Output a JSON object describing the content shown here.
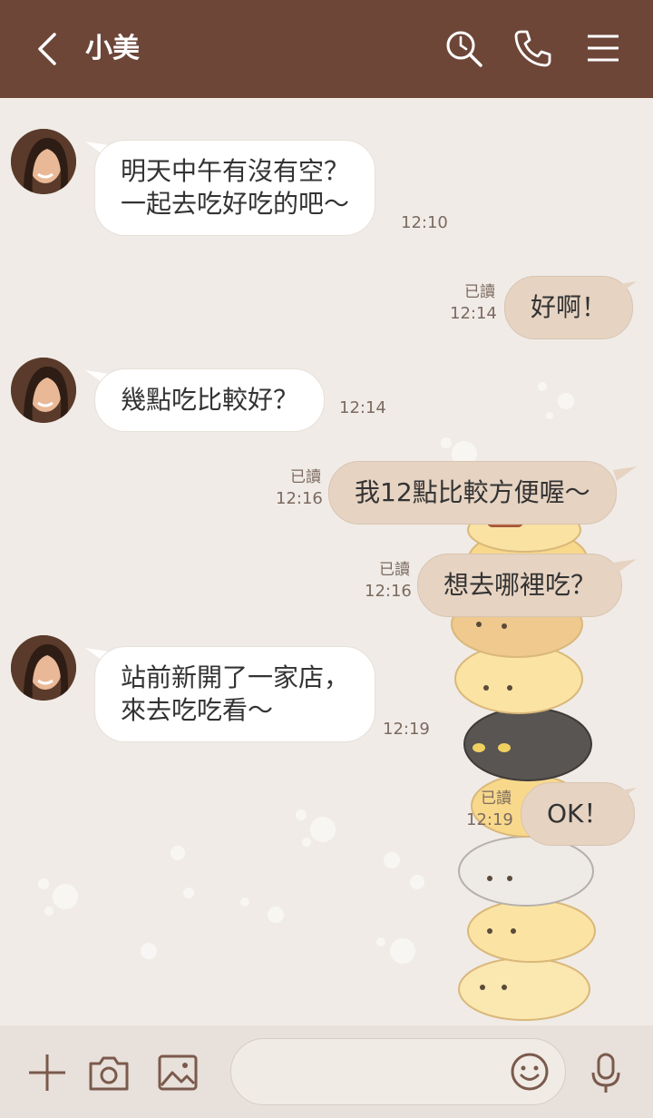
{
  "header": {
    "title": "小美",
    "back_icon": "chevron-left-icon",
    "icons": [
      "search-history-icon",
      "phone-icon",
      "menu-icon"
    ]
  },
  "colors": {
    "header_bg": "#6d4638",
    "chat_bg": "#f0ebe6",
    "outgoing_bubble": "#e6d3c2",
    "incoming_bubble": "#ffffff",
    "footer_bg": "#e8e0da"
  },
  "messages": [
    {
      "dir": "in",
      "lines": [
        "明天中午有沒有空？",
        "一起去吃好吃的吧～"
      ],
      "time": "12:10"
    },
    {
      "dir": "out",
      "lines": [
        "好啊！"
      ],
      "read": "已讀",
      "time": "12:14"
    },
    {
      "dir": "in",
      "lines": [
        "幾點吃比較好？"
      ],
      "time": "12:14"
    },
    {
      "dir": "out",
      "lines": [
        "我12點比較方便喔～"
      ],
      "read": "已讀",
      "time": "12:16"
    },
    {
      "dir": "out",
      "lines": [
        "想去哪裡吃？"
      ],
      "read": "已讀",
      "time": "12:16"
    },
    {
      "dir": "in",
      "lines": [
        "站前新開了一家店，",
        "來去吃吃看～"
      ],
      "time": "12:19"
    },
    {
      "dir": "out",
      "lines": [
        "OK！"
      ],
      "read": "已讀",
      "time": "12:19"
    }
  ],
  "footer": {
    "icons": [
      "plus-icon",
      "camera-icon",
      "image-icon",
      "emoji-icon",
      "microphone-icon"
    ],
    "input_placeholder": ""
  }
}
